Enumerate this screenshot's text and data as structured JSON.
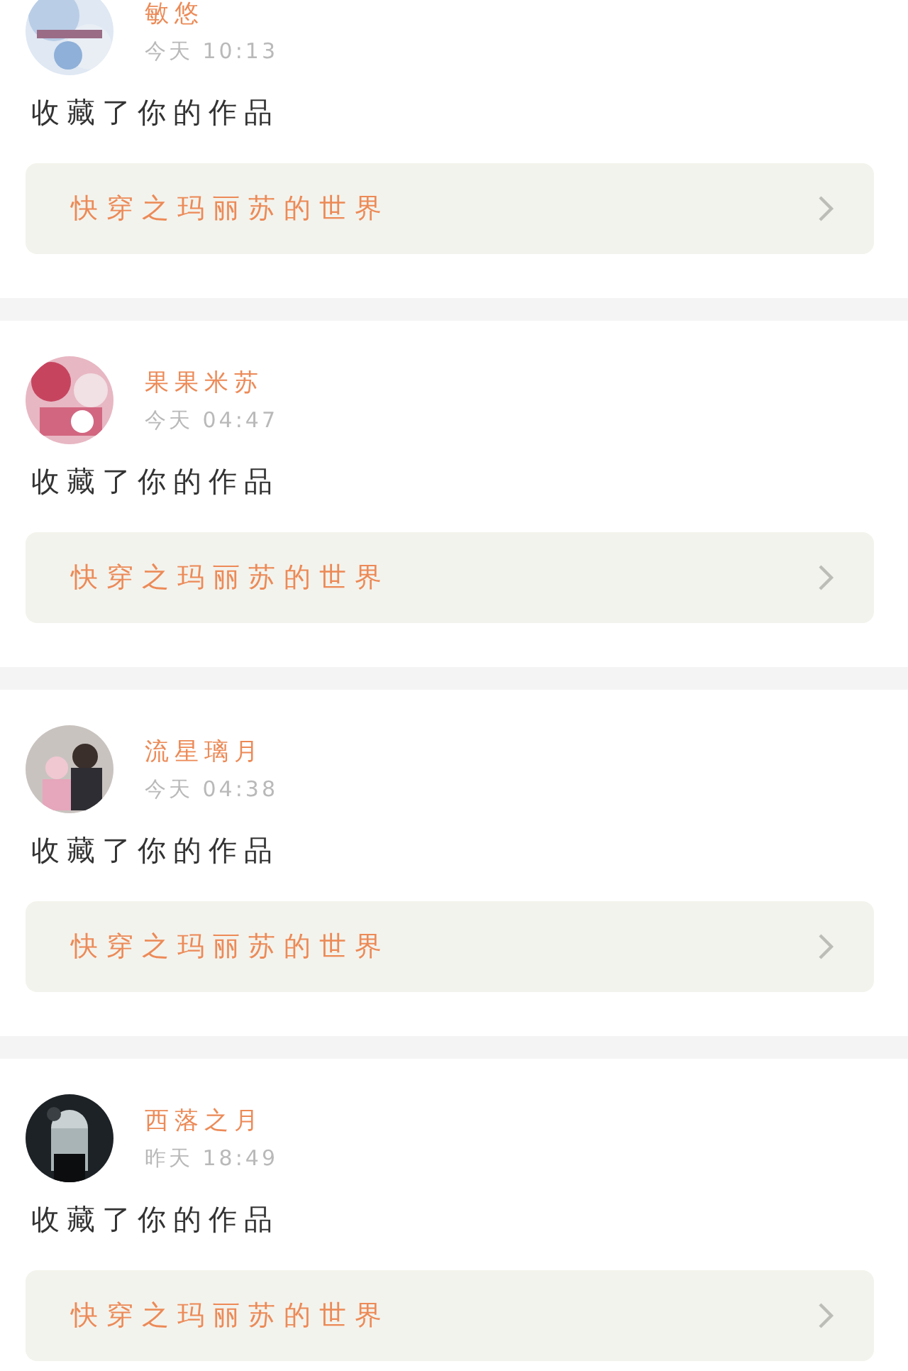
{
  "notifications": [
    {
      "user": "敏悠",
      "time": "今天 10:13",
      "action": "收藏了你的作品",
      "work": "快穿之玛丽苏的世界"
    },
    {
      "user": "果果米苏",
      "time": "今天 04:47",
      "action": "收藏了你的作品",
      "work": "快穿之玛丽苏的世界"
    },
    {
      "user": "流星璃月",
      "time": "今天 04:38",
      "action": "收藏了你的作品",
      "work": "快穿之玛丽苏的世界"
    },
    {
      "user": "西落之月",
      "time": "昨天 18:49",
      "action": "收藏了你的作品",
      "work": "快穿之玛丽苏的世界"
    }
  ]
}
